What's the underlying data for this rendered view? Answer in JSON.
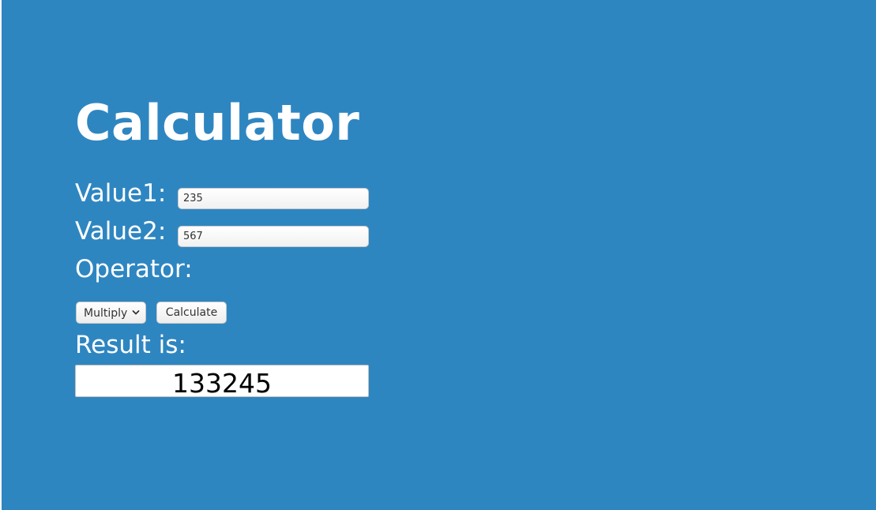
{
  "page": {
    "title": "Calculator",
    "background_color": "#2e86c1"
  },
  "form": {
    "value1_label": "Value1:",
    "value1": "235",
    "value2_label": "Value2:",
    "value2": "567",
    "operator_label": "Operator:",
    "operator_selected": "Multiply",
    "calculate_label": "Calculate"
  },
  "result": {
    "label": "Result is:",
    "value": "133245"
  },
  "icons": {
    "operator_dropdown": "chevron-down-icon"
  }
}
